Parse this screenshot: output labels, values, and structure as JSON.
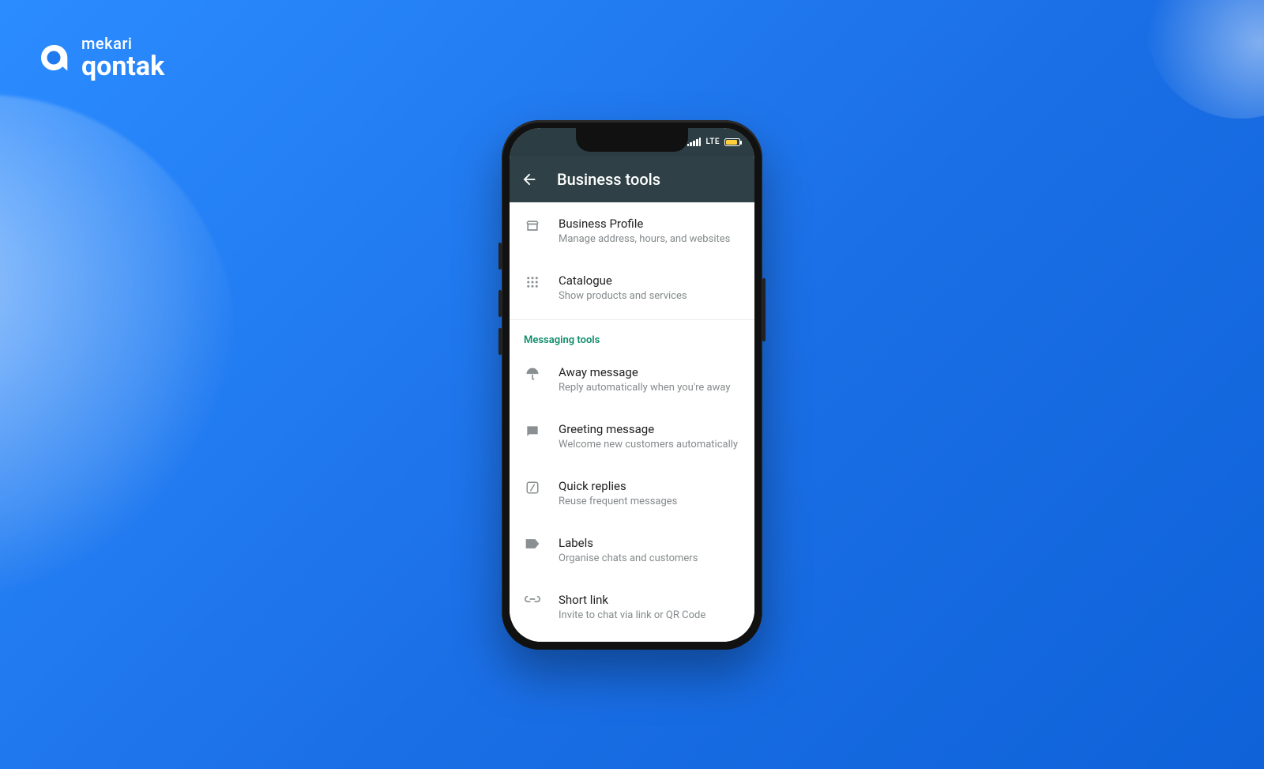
{
  "brand": {
    "top": "mekari",
    "bottom": "qontak"
  },
  "statusbar": {
    "network": "LTE"
  },
  "appbar": {
    "title": "Business tools"
  },
  "sections": {
    "top": [
      {
        "title": "Business Profile",
        "sub": "Manage address, hours, and websites"
      },
      {
        "title": "Catalogue",
        "sub": "Show products and services"
      }
    ],
    "messaging_label": "Messaging tools",
    "messaging": [
      {
        "title": "Away message",
        "sub": "Reply automatically when you're away"
      },
      {
        "title": "Greeting message",
        "sub": "Welcome new customers automatically"
      },
      {
        "title": "Quick replies",
        "sub": "Reuse frequent messages"
      },
      {
        "title": "Labels",
        "sub": "Organise chats and customers"
      },
      {
        "title": "Short link",
        "sub": "Invite to chat via link or QR Code"
      }
    ]
  }
}
